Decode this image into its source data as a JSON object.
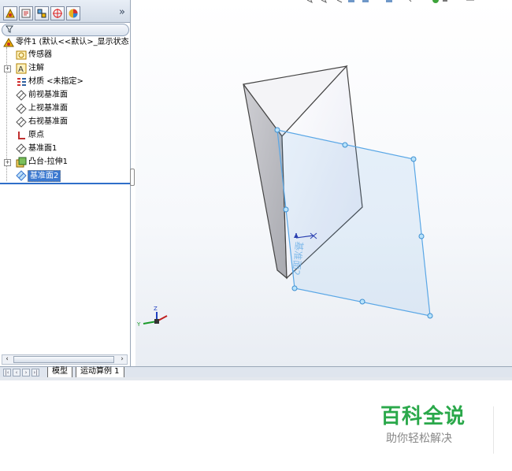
{
  "feature_manager": {
    "tabs": [
      {
        "icon": "feature-manager-tab-icon"
      },
      {
        "icon": "property-manager-tab-icon"
      },
      {
        "icon": "configuration-manager-tab-icon"
      },
      {
        "icon": "dimxpert-tab-icon"
      },
      {
        "icon": "display-manager-tab-icon"
      }
    ],
    "more": "»",
    "tree": {
      "root": "零件1 (默认<<默认>_显示状态",
      "items": [
        {
          "label": "传感器",
          "icon": "sensor-icon"
        },
        {
          "label": "注解",
          "icon": "annotation-icon"
        },
        {
          "label": "材质 <未指定>",
          "icon": "material-icon"
        },
        {
          "label": "前视基准面",
          "icon": "plane-icon"
        },
        {
          "label": "上视基准面",
          "icon": "plane-icon"
        },
        {
          "label": "右视基准面",
          "icon": "plane-icon"
        },
        {
          "label": "原点",
          "icon": "origin-icon"
        },
        {
          "label": "基准面1",
          "icon": "plane-icon"
        },
        {
          "label": "凸台-拉伸1",
          "icon": "extrude-icon"
        },
        {
          "label": "基准面2",
          "icon": "plane-icon",
          "selected": true
        }
      ]
    }
  },
  "bottom_tabs": {
    "tab1": "模型",
    "tab2": "运动算例 1"
  },
  "viewport": {
    "plane_label": "基准面2",
    "triad": {
      "x": "X",
      "y": "Y",
      "z": "Z"
    }
  },
  "watermark": {
    "title": "百科全说",
    "subtitle": "助你轻松解决",
    "color": "#2aa84a"
  },
  "colors": {
    "selection": "#3b78d0",
    "plane": "#5aa7e6"
  }
}
